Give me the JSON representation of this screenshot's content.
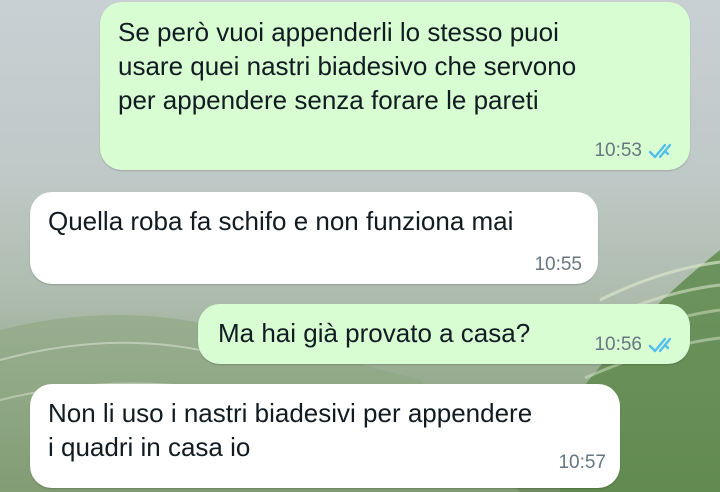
{
  "chat": {
    "messages": [
      {
        "direction": "outgoing",
        "text": "Se però vuoi appenderli lo stesso puoi\nusare quei nastri biadesivo che servono\nper appendere senza forare le pareti",
        "time": "10:53",
        "status_icon": "double-check-read-icon"
      },
      {
        "direction": "incoming",
        "text": "Quella roba fa schifo e non funziona mai",
        "time": "10:55"
      },
      {
        "direction": "outgoing",
        "text": "Ma hai già provato a casa?",
        "time": "10:56",
        "status_icon": "double-check-read-icon"
      },
      {
        "direction": "incoming",
        "text": "Non li uso i nastri biadesivi per appendere\ni quadri in casa io",
        "time": "10:57"
      }
    ]
  },
  "colors": {
    "outgoing_bubble": "#d9fdd3",
    "incoming_bubble": "#ffffff",
    "read_ticks": "#53bdeb",
    "meta_text": "#667781"
  }
}
